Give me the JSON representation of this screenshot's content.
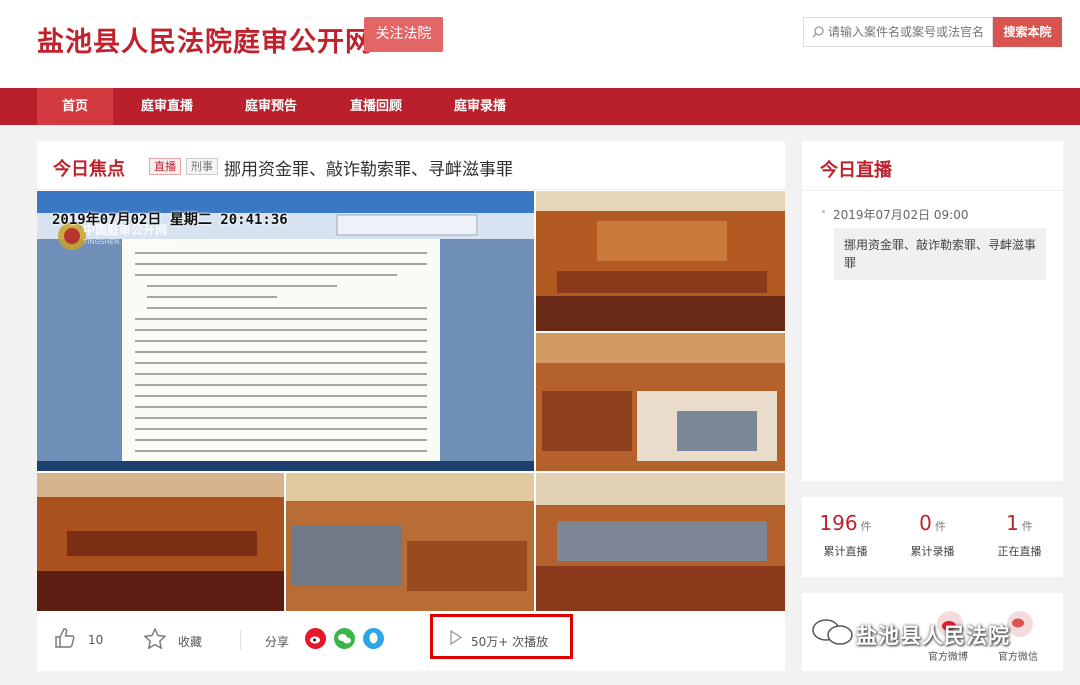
{
  "header": {
    "site_title": "盐池县人民法院庭审公开网",
    "follow_label": "关注法院",
    "search_placeholder": "请输入案件名或案号或法官名",
    "search_button": "搜索本院"
  },
  "nav": {
    "items": [
      {
        "label": "首页",
        "active": true
      },
      {
        "label": "庭审直播",
        "active": false
      },
      {
        "label": "庭审预告",
        "active": false
      },
      {
        "label": "直播回顾",
        "active": false
      },
      {
        "label": "庭审录播",
        "active": false
      }
    ]
  },
  "focus": {
    "title": "今日焦点",
    "tag_live": "直播",
    "tag_type": "刑事",
    "case_title": "挪用资金罪、敲诈勒索罪、寻衅滋事罪",
    "video": {
      "datetime": "2019年07月02日  星期二  20:41:36",
      "watermark": "中国庭审公开网",
      "watermark_sub": "TINGSHEN.COURT.GOV.CN"
    },
    "toolbar": {
      "likes": "10",
      "collect_label": "收藏",
      "share_label": "分享",
      "views": "50万+ 次播放"
    }
  },
  "today_live": {
    "title": "今日直播",
    "date": "2019年07月02日 09:00",
    "case": "挪用资金罪、敲诈勒索罪、寻衅滋事罪"
  },
  "stats": [
    {
      "num": "196",
      "unit": "件",
      "label": "累计直播"
    },
    {
      "num": "0",
      "unit": "件",
      "label": "累计录播"
    },
    {
      "num": "1",
      "unit": "件",
      "label": "正在直播"
    }
  ],
  "social": {
    "weibo_label": "官方微博",
    "wechat_label": "官方微信",
    "watermark_text": "盐池县人民法院"
  },
  "colors": {
    "brand_red": "#c0222d",
    "nav_red": "#b9202b",
    "highlight_box": "#e00000"
  }
}
